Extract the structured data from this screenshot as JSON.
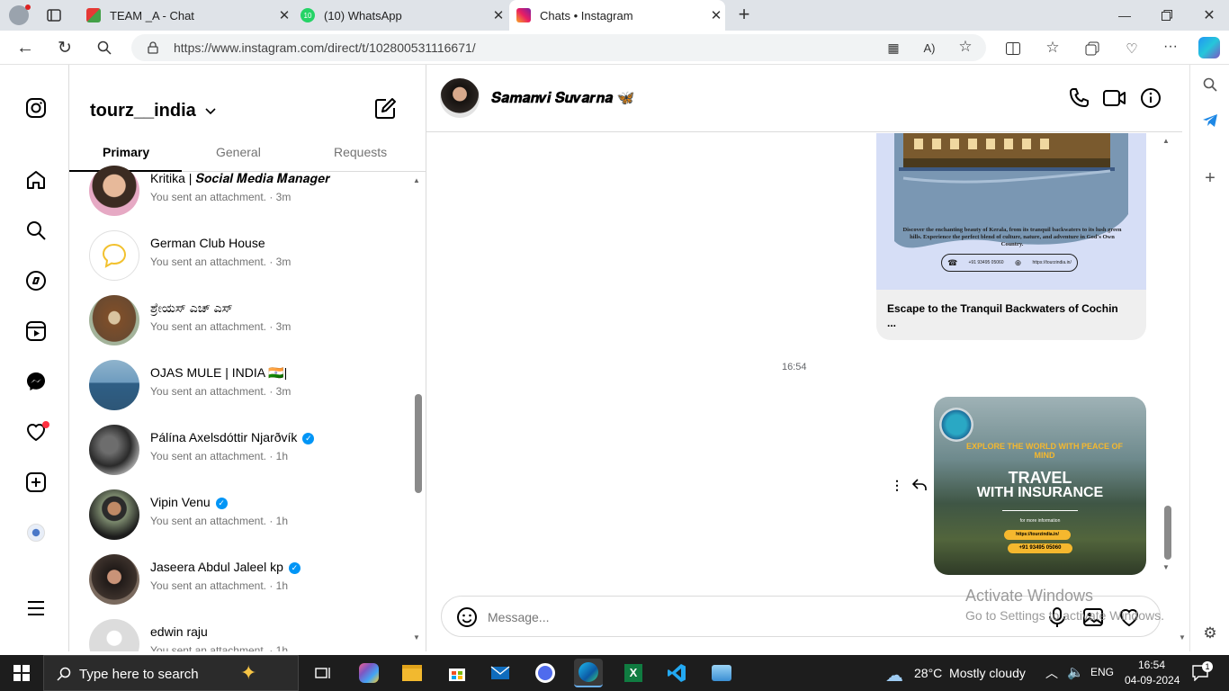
{
  "browser": {
    "tabs": [
      {
        "label": "TEAM _A - Chat",
        "icon": "team-chat-icon"
      },
      {
        "label": "(10) WhatsApp",
        "badge": "10",
        "icon": "whatsapp-icon"
      },
      {
        "label": "Chats • Instagram",
        "icon": "instagram-icon",
        "active": true
      }
    ],
    "url": "https://www.instagram.com/direct/t/102800531116671/"
  },
  "inbox": {
    "account": "tourz__india",
    "tabs": [
      "Primary",
      "General",
      "Requests"
    ],
    "chats": [
      {
        "name": "Kritika | 𝑺𝒐𝒄𝒊𝒂𝒍 𝑴𝒆𝒅𝒊𝒂 𝑴𝒂𝒏𝒂𝒈𝒆𝒓",
        "sub": "You sent an attachment. · 3m",
        "verified": false,
        "color": "#c9a07a"
      },
      {
        "name": "German Club House",
        "sub": "You sent an attachment. · 3m",
        "verified": false,
        "color": "#ffffff"
      },
      {
        "name": "ಶ್ರೇಯಸ್ ಎಚ್ ಎಸ್",
        "sub": "You sent an attachment. · 3m",
        "verified": false,
        "color": "#8a6e4e"
      },
      {
        "name": "OJAS MULE | INDIA 🇮🇳|",
        "sub": "You sent an attachment. · 3m",
        "verified": false,
        "color": "#4f86a8"
      },
      {
        "name": "Pálína Axelsdóttir Njarðvík",
        "sub": "You sent an attachment. · 1h",
        "verified": true,
        "color": "#3b3b3b"
      },
      {
        "name": "Vipin Venu",
        "sub": "You sent an attachment. · 1h",
        "verified": true,
        "color": "#5a5f52"
      },
      {
        "name": "Jaseera Abdul Jaleel kp",
        "sub": "You sent an attachment. · 1h",
        "verified": true,
        "color": "#4a3b36"
      },
      {
        "name": "edwin raju",
        "sub": "You sent an attachment. · 1h",
        "verified": false,
        "color": "#dddddd"
      }
    ]
  },
  "thread": {
    "contact": "𝑺𝒂𝒎𝒂𝒏𝒗𝒊 𝑺𝒖𝒗𝒂𝒓𝒏𝒂 🦋",
    "card1": {
      "text": "Discover the enchanting beauty of Kerala, from its tranquil backwaters to its lush green hills. Experience the perfect blend of culture, nature, and adventure in God's Own Country.",
      "contact_label": "Contact Us",
      "phone": "+91 93495 05060",
      "website_label": "Website Us",
      "website": "https://tourzindia.in/",
      "caption": "Escape to the Tranquil Backwaters of Cochin",
      "caption_more": "..."
    },
    "timestamp": "16:54",
    "card2": {
      "headline": "EXPLORE THE WORLD WITH PEACE OF MIND",
      "title1": "TRAVEL",
      "title2": "WITH INSURANCE",
      "more": "for more information",
      "url": "https://tourzindia.in/",
      "phone": "+91 93495 05060"
    },
    "message_placeholder": "Message...",
    "watermark1": "Activate Windows",
    "watermark2": "Go to Settings to activate Windows."
  },
  "taskbar": {
    "search": "Type here to search",
    "weather": "28°C  Mostly cloudy",
    "lang": "ENG",
    "time": "16:54",
    "date": "04-09-2024",
    "notif_count": "1"
  }
}
